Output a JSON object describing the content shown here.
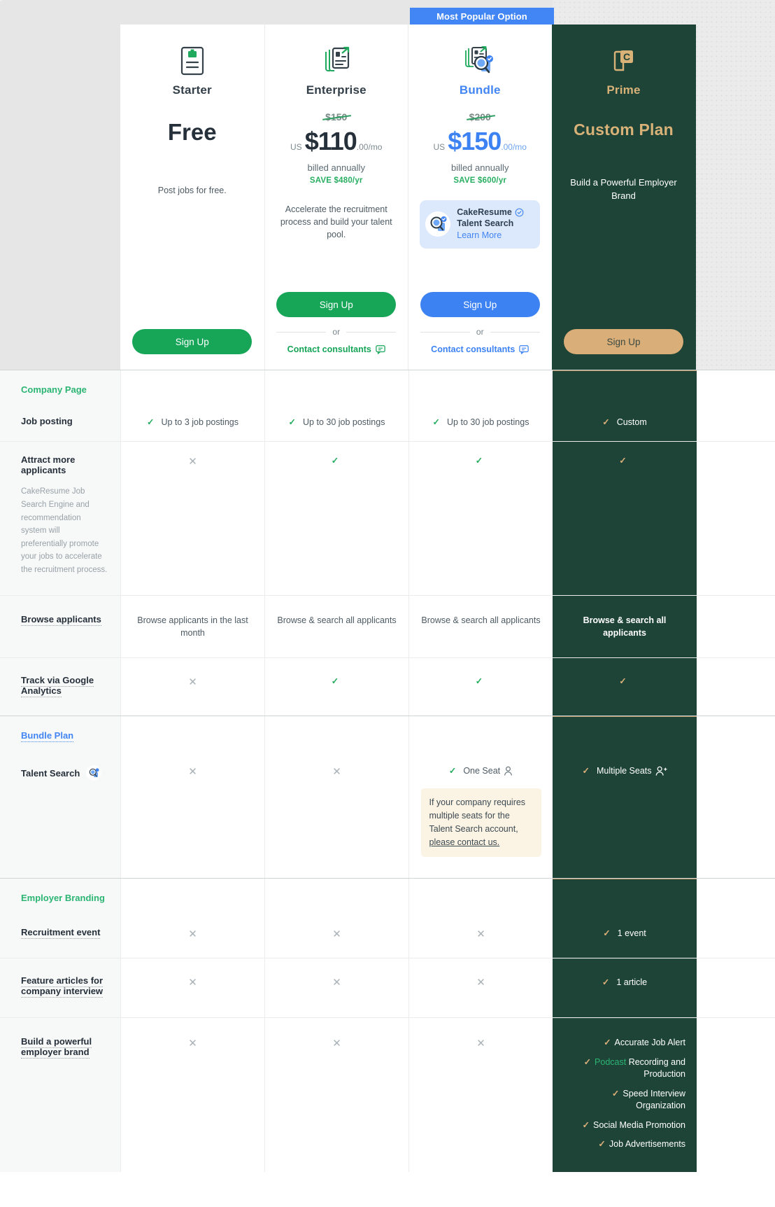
{
  "badge": {
    "most_popular": "Most Popular Option"
  },
  "plans": [
    {
      "id": "starter",
      "name": "Starter",
      "icon": "document-briefcase-icon",
      "price_display": "Free",
      "description": "Post jobs for free.",
      "cta": "Sign Up"
    },
    {
      "id": "enterprise",
      "name": "Enterprise",
      "icon": "documents-growth-icon",
      "price_old": "$150",
      "currency": "US",
      "price_main": "$110",
      "price_decimals": ".00/mo",
      "billing": "billed annually",
      "save": "SAVE $480/yr",
      "description": "Accelerate the recruitment process and build your talent pool.",
      "cta": "Sign Up",
      "or_label": "or",
      "contact": "Contact consultants"
    },
    {
      "id": "bundle",
      "name": "Bundle",
      "icon": "documents-search-icon",
      "price_old": "$200",
      "currency": "US",
      "price_main": "$150",
      "price_decimals": ".00/mo",
      "billing": "billed annually",
      "save": "SAVE $600/yr",
      "talent_box": {
        "title_line1": "CakeResume",
        "title_line2": "Talent Search",
        "verified_icon": "verified-check-icon",
        "learn_more": "Learn More"
      },
      "cta": "Sign Up",
      "or_label": "or",
      "contact": "Contact consultants"
    },
    {
      "id": "prime",
      "name": "Prime",
      "icon": "cake-logo-icon",
      "price_display": "Custom Plan",
      "description": "Build a Powerful Employer Brand",
      "cta": "Sign Up"
    }
  ],
  "sections": [
    {
      "title": "Company Page",
      "rows": [
        {
          "label": "Job posting",
          "dotted": false,
          "cells": [
            {
              "type": "check-text",
              "text": "Up to 3 job postings"
            },
            {
              "type": "check-text",
              "text": "Up to 30 job postings"
            },
            {
              "type": "check-text",
              "text": "Up to 30 job postings"
            },
            {
              "type": "check-text",
              "text": "Custom"
            }
          ]
        },
        {
          "label": "Attract more applicants",
          "dotted": false,
          "sub": "CakeResume Job Search Engine and recommendation system will preferentially promote your jobs to accelerate the recruitment process.",
          "cells": [
            {
              "type": "cross"
            },
            {
              "type": "check"
            },
            {
              "type": "check"
            },
            {
              "type": "check"
            }
          ]
        },
        {
          "label": "Browse applicants",
          "dotted": true,
          "cells": [
            {
              "type": "text",
              "text": "Browse applicants in the last month"
            },
            {
              "type": "text",
              "text": "Browse & search all applicants"
            },
            {
              "type": "text",
              "text": "Browse & search all applicants"
            },
            {
              "type": "text",
              "text": "Browse & search all applicants"
            }
          ]
        },
        {
          "label": "Track via Google Analytics",
          "dotted": true,
          "cells": [
            {
              "type": "cross"
            },
            {
              "type": "check"
            },
            {
              "type": "check"
            },
            {
              "type": "check"
            }
          ]
        }
      ]
    },
    {
      "title": "Bundle Plan",
      "title_is_link": true,
      "rows": [
        {
          "label": "Talent Search",
          "dotted": false,
          "icon": "talent-search-icon",
          "cells": [
            {
              "type": "cross"
            },
            {
              "type": "cross"
            },
            {
              "type": "check-text-icon",
              "text": "One Seat",
              "trailing_icon": "single-user-icon",
              "note": {
                "text_before": "If your company requires multiple seats for the Talent Search account, ",
                "link": "please contact us."
              }
            },
            {
              "type": "check-text-icon",
              "text": "Multiple Seats",
              "trailing_icon": "multi-user-icon"
            }
          ]
        }
      ]
    },
    {
      "title": "Employer Branding",
      "rows": [
        {
          "label": "Recruitment event",
          "dotted": true,
          "cells": [
            {
              "type": "cross"
            },
            {
              "type": "cross"
            },
            {
              "type": "cross"
            },
            {
              "type": "check-text",
              "text": "1 event"
            }
          ]
        },
        {
          "label": "Feature articles for company interview",
          "dotted": true,
          "cells": [
            {
              "type": "cross"
            },
            {
              "type": "cross"
            },
            {
              "type": "cross"
            },
            {
              "type": "check-text",
              "text": "1 article"
            }
          ]
        },
        {
          "label": "Build a powerful employer brand",
          "dotted": true,
          "cells": [
            {
              "type": "cross"
            },
            {
              "type": "cross"
            },
            {
              "type": "cross"
            },
            {
              "type": "list",
              "items": [
                {
                  "text": "Accurate Job Alert"
                },
                {
                  "highlight": "Podcast",
                  "text": " Recording and Production"
                },
                {
                  "text": "Speed Interview Organization"
                },
                {
                  "text": "Social Media Promotion"
                },
                {
                  "text": "Job Advertisements"
                }
              ]
            }
          ]
        }
      ]
    }
  ],
  "colors": {
    "green": "#17a558",
    "blue": "#3c82f3",
    "gold": "#d9ae78",
    "dark_green": "#1e4438",
    "section_green": "#2bb573"
  }
}
